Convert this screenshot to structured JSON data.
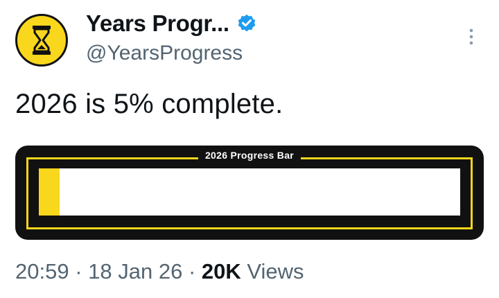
{
  "author": {
    "display_name": "Years Progr...",
    "handle": "@YearsProgress",
    "avatar_icon": "hourglass-icon",
    "verified_icon": "verified-badge-icon"
  },
  "tweet": {
    "text": "2026 is 5% complete."
  },
  "progress_card": {
    "title": "2026 Progress Bar",
    "progress_fraction": 0.05,
    "colors": {
      "background": "#111111",
      "accent": "#f9d71c",
      "track": "#ffffff"
    }
  },
  "meta": {
    "time": "20:59",
    "separator": "·",
    "date": "18 Jan 26",
    "views_count": "20K",
    "views_label": "Views"
  },
  "colors": {
    "verified": "#1d9bf0",
    "secondary_text": "#536471"
  }
}
